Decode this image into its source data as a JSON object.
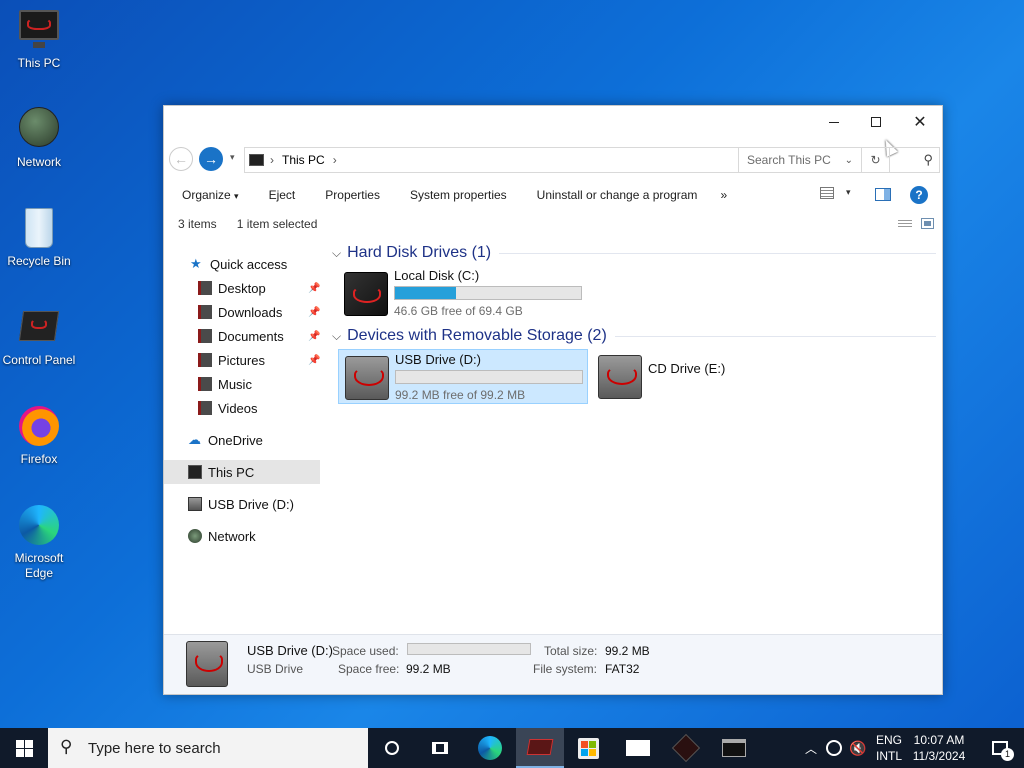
{
  "desktop": {
    "icons": [
      {
        "label": "This PC"
      },
      {
        "label": "Network"
      },
      {
        "label": "Recycle Bin"
      },
      {
        "label": "Control Panel"
      },
      {
        "label": "Firefox"
      },
      {
        "label": "Microsoft Edge"
      }
    ]
  },
  "window": {
    "address": {
      "root": "This PC"
    },
    "search_placeholder": "Search This PC",
    "commands": [
      "Organize",
      "Eject",
      "Properties",
      "System properties",
      "Uninstall or change a program"
    ],
    "more_chevron": "»",
    "status": {
      "items": "3 items",
      "selected": "1 item selected"
    },
    "nav": {
      "quick_access": "Quick access",
      "pinned": [
        "Desktop",
        "Downloads",
        "Documents",
        "Pictures"
      ],
      "unpinned": [
        "Music",
        "Videos"
      ],
      "onedrive": "OneDrive",
      "this_pc": "This PC",
      "usb": "USB Drive (D:)",
      "network": "Network"
    },
    "groups": {
      "hdd": "Hard Disk Drives (1)",
      "removable": "Devices with Removable Storage (2)"
    },
    "drives": {
      "c": {
        "name": "Local Disk (C:)",
        "free": "46.6 GB free of 69.4 GB",
        "used_fraction": 0.33
      },
      "d": {
        "name": "USB Drive (D:)",
        "free": "99.2 MB free of 99.2 MB",
        "used_fraction": 0.0
      },
      "e": {
        "name": "CD Drive (E:)"
      }
    },
    "details": {
      "name": "USB Drive (D:)",
      "type": "USB Drive",
      "space_used_label": "Space used:",
      "space_free_label": "Space free:",
      "space_free": "99.2 MB",
      "total_size_label": "Total size:",
      "total_size": "99.2 MB",
      "file_system_label": "File system:",
      "file_system": "FAT32"
    }
  },
  "taskbar": {
    "search_placeholder": "Type here to search",
    "lang_top": "ENG",
    "lang_bottom": "INTL",
    "time": "10:07 AM",
    "date": "11/3/2024",
    "notification_count": "1"
  }
}
